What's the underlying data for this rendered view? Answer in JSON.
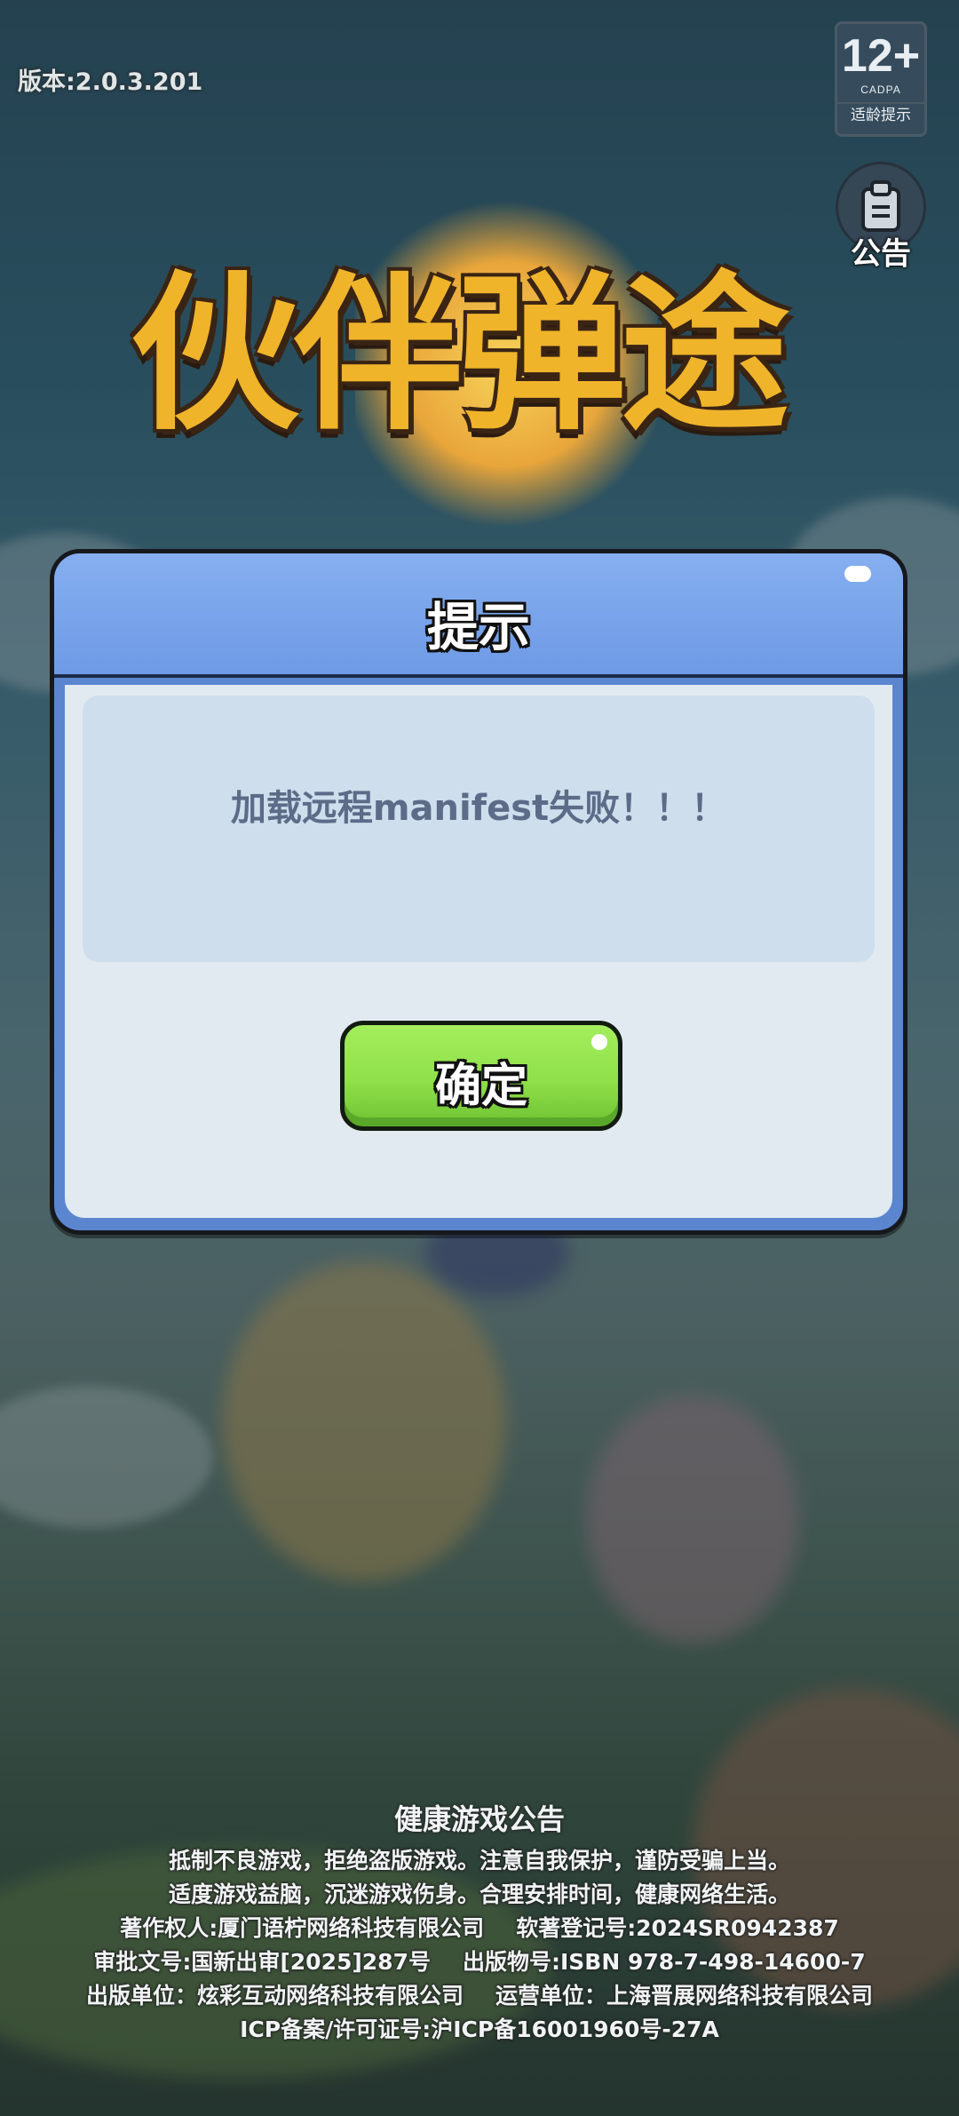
{
  "top_bar": {
    "version_label": "版本:2.0.3.201",
    "age_rating": {
      "age": "12+",
      "org": "CADPA",
      "hint": "适龄提示"
    },
    "notice_button": {
      "icon": "clipboard-icon",
      "label": "公告"
    }
  },
  "logo": {
    "text": "伙伴弹途"
  },
  "dialog": {
    "title": "提示",
    "message": "加载远程manifest失败！！！",
    "confirm_label": "确定"
  },
  "footer": {
    "title": "健康游戏公告",
    "lines": [
      "抵制不良游戏，拒绝盗版游戏。注意自我保护，谨防受骗上当。",
      "适度游戏益脑，沉迷游戏伤身。合理安排时间，健康网络生活。"
    ],
    "copyright_owner": "著作权人:厦门语柠网络科技有限公司",
    "software_reg": "软著登记号:2024SR0942387",
    "approval_no": "审批文号:国新出审[2025]287号",
    "publication_no": "出版物号:ISBN 978-7-498-14600-7",
    "publisher": "出版单位：炫彩互动网络科技有限公司",
    "operator": "运营单位：上海晋展网络科技有限公司",
    "icp": "ICP备案/许可证号:沪ICP备16001960号-27A"
  },
  "colors": {
    "dialog_header": "#7aa4ec",
    "dialog_body": "#e1eaf1",
    "message_box": "#cfdeec",
    "message_text": "#5c6b88",
    "confirm_button": "#95e04c",
    "logo_text": "#f0b42b"
  }
}
